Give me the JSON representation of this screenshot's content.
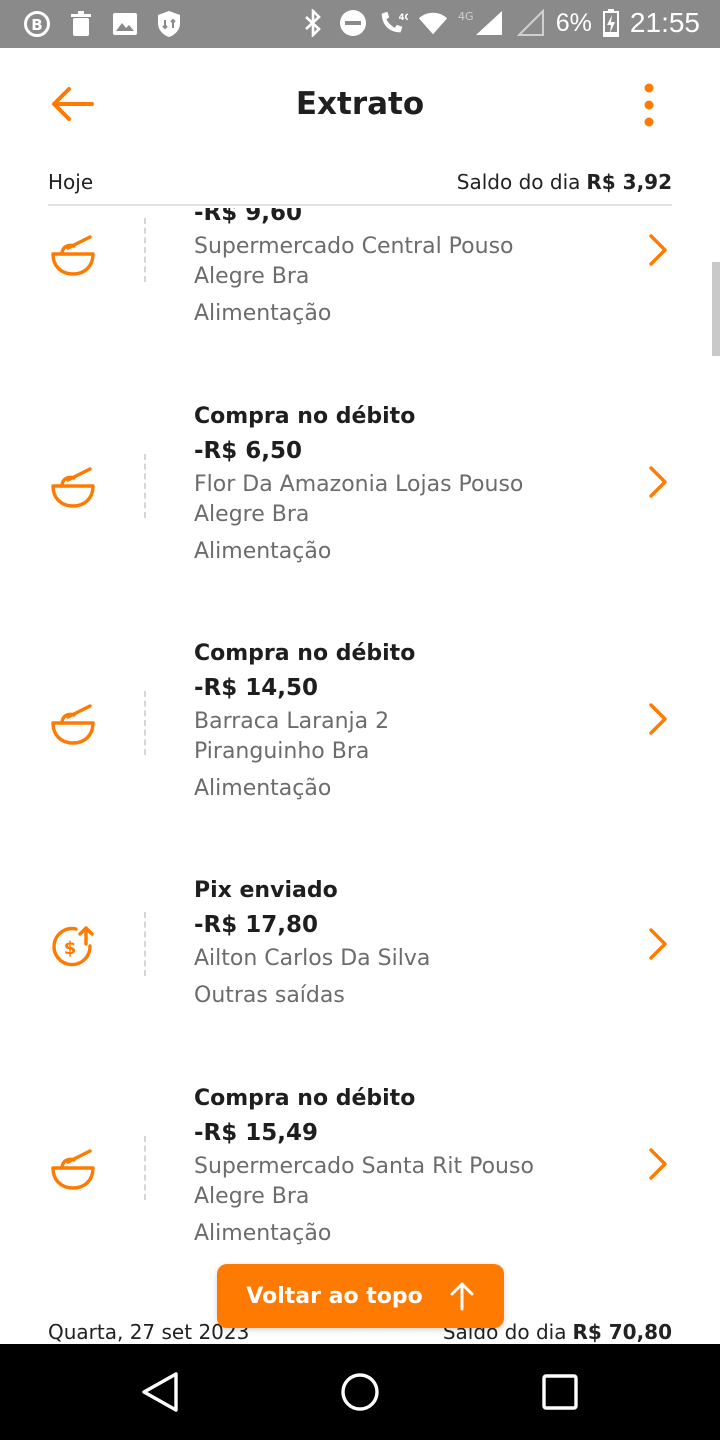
{
  "status_bar": {
    "battery_percent": "6%",
    "time": "21:55",
    "network_label": "4G"
  },
  "header": {
    "title": "Extrato"
  },
  "today": {
    "label": "Hoje",
    "balance_label": "Saldo do dia",
    "balance_value": "R$ 3,92"
  },
  "transactions": [
    {
      "type": "",
      "amount": "-R$ 9,60",
      "desc1": "Supermercado Central   Pouso",
      "desc2": "Alegre  Bra",
      "category": "Alimentação",
      "icon": "food-bowl-icon"
    },
    {
      "type": "Compra no débito",
      "amount": "-R$ 6,50",
      "desc1": "Flor Da Amazonia Lojas Pouso",
      "desc2": "Alegre  Bra",
      "category": "Alimentação",
      "icon": "food-bowl-icon"
    },
    {
      "type": "Compra no débito",
      "amount": "-R$ 14,50",
      "desc1": "Barraca Laranja 2",
      "desc2": "Piranguinho   Bra",
      "category": "Alimentação",
      "icon": "food-bowl-icon"
    },
    {
      "type": "Pix enviado",
      "amount": "-R$ 17,80",
      "desc1": "Ailton Carlos Da Silva",
      "desc2": "",
      "category": "Outras saídas",
      "icon": "money-out-icon"
    },
    {
      "type": "Compra no débito",
      "amount": "-R$ 15,49",
      "desc1": "Supermercado Santa Rit Pouso",
      "desc2": "Alegre  Bra",
      "category": "Alimentação",
      "icon": "food-bowl-icon"
    }
  ],
  "scroll_top_button": {
    "label": "Voltar ao topo"
  },
  "previous_day": {
    "label": "Quarta, 27 set 2023",
    "balance_label": "Saldo do dia",
    "balance_value": "R$ 70,80"
  },
  "colors": {
    "accent": "#ff7a00",
    "text": "#1e1e1e",
    "muted": "#6c6c6c"
  }
}
